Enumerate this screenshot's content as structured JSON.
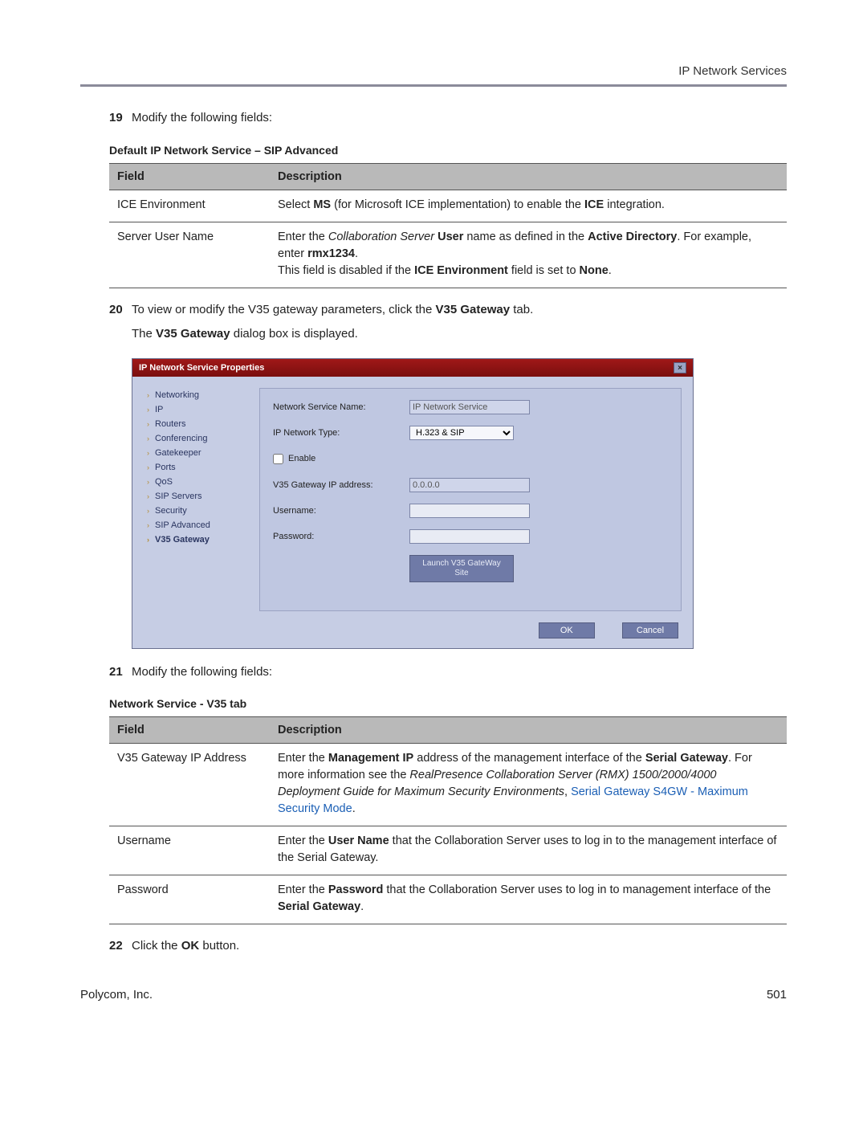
{
  "header": {
    "section": "IP Network Services"
  },
  "steps": {
    "s19": {
      "num": "19",
      "text": "Modify the following fields:"
    },
    "s20": {
      "num": "20",
      "pre": "To view or modify the V35 gateway parameters, click the ",
      "bold": "V35 Gateway",
      "post": " tab.",
      "sub_pre": "The ",
      "sub_bold": "V35 Gateway",
      "sub_post": " dialog box is displayed."
    },
    "s21": {
      "num": "21",
      "text": "Modify the following fields:"
    },
    "s22": {
      "num": "22",
      "pre": "Click the ",
      "bold": "OK",
      "post": " button."
    }
  },
  "table1": {
    "title": "Default IP Network Service – SIP Advanced",
    "head_field": "Field",
    "head_desc": "Description",
    "row1_field": "ICE Environment",
    "row1_pre": "Select ",
    "row1_b1": "MS",
    "row1_mid": " (for Microsoft ICE implementation) to enable the ",
    "row1_b2": "ICE",
    "row1_post": " integration.",
    "row2_field": "Server User Name",
    "row2_l1_pre": "Enter the ",
    "row2_l1_i": "Collaboration Server",
    "row2_l1_mid": " ",
    "row2_l1_b1": "User",
    "row2_l1_mid2": " name as defined in the ",
    "row2_l1_b2": "Active Directory",
    "row2_l1_post": ". For example, enter ",
    "row2_l1_b3": "rmx1234",
    "row2_l1_end": ".",
    "row2_l2_pre": "This field is disabled if the ",
    "row2_l2_b1": "ICE Environment",
    "row2_l2_mid": " field is set to ",
    "row2_l2_b2": "None",
    "row2_l2_post": "."
  },
  "table2": {
    "title": "Network Service - V35 tab",
    "head_field": "Field",
    "head_desc": "Description",
    "r1_field": "V35 Gateway IP Address",
    "r1_pre": "Enter the ",
    "r1_b1": "Management IP",
    "r1_mid": " address of the management interface of the ",
    "r1_b2": "Serial Gateway",
    "r1_post": ". For more information see the ",
    "r1_i": "RealPresence Collaboration Server (RMX) 1500/2000/4000 Deployment Guide for Maximum Security Environments",
    "r1_sep": ", ",
    "r1_link": "Serial Gateway S4GW - Maximum Security Mode",
    "r1_end": ".",
    "r2_field": "Username",
    "r2_pre": "Enter the ",
    "r2_b": "User Name",
    "r2_post": " that the Collaboration Server uses to log in to the management interface of the Serial Gateway.",
    "r3_field": "Password",
    "r3_pre": "Enter the ",
    "r3_b": "Password",
    "r3_mid": " that the Collaboration Server uses to log in to management interface of the ",
    "r3_b2": "Serial Gateway",
    "r3_post": "."
  },
  "dialog": {
    "title": "IP Network Service Properties",
    "close": "×",
    "nav": {
      "n0": "Networking",
      "n1": "IP",
      "n2": "Routers",
      "n3": "Conferencing",
      "n4": "Gatekeeper",
      "n5": "Ports",
      "n6": "QoS",
      "n7": "SIP Servers",
      "n8": "Security",
      "n9": "SIP Advanced",
      "n10": "V35 Gateway"
    },
    "form": {
      "l_service": "Network Service Name:",
      "v_service": "IP Network Service",
      "l_type": "IP Network Type:",
      "v_type": "H.323 & SIP",
      "l_enable": "Enable",
      "l_ip": "V35 Gateway IP address:",
      "v_ip": "0.0.0.0",
      "l_user": "Username:",
      "l_pass": "Password:",
      "launch": "Launch V35 GateWay Site"
    },
    "ok": "OK",
    "cancel": "Cancel"
  },
  "footer": {
    "left": "Polycom, Inc.",
    "right": "501"
  }
}
